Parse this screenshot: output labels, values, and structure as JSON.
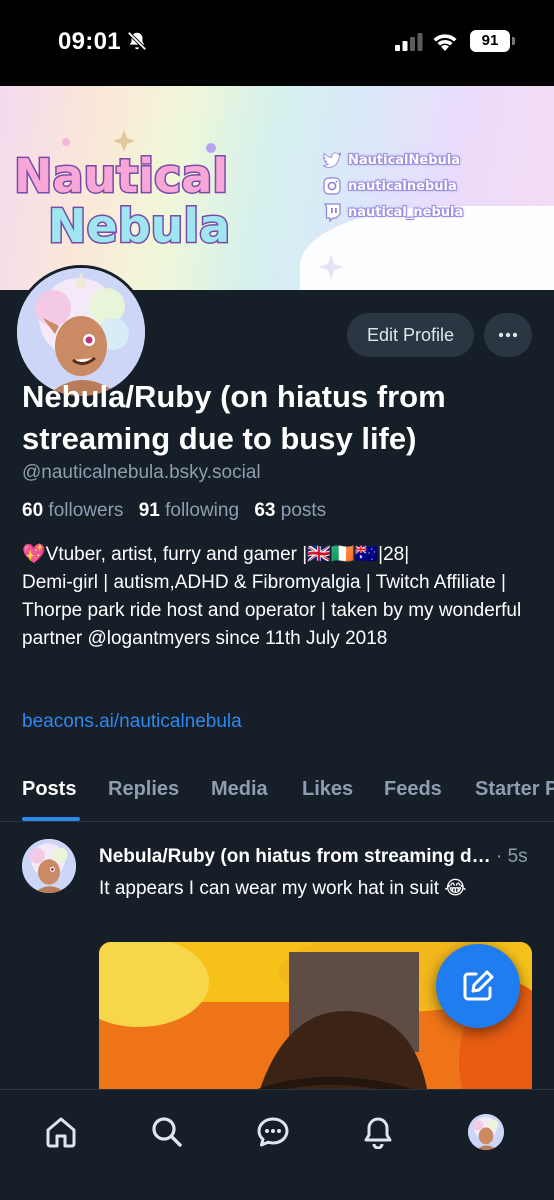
{
  "status_bar": {
    "time": "09:01",
    "battery": "91"
  },
  "banner": {
    "logo_line1": "Nautical",
    "logo_line2": "Nebula",
    "socials": [
      {
        "icon": "twitter-icon",
        "text": "NauticalNebula"
      },
      {
        "icon": "instagram-icon",
        "text": "nauticalnebula"
      },
      {
        "icon": "twitch-icon",
        "text": "nautical_nebula"
      }
    ]
  },
  "profile": {
    "edit_button": "Edit Profile",
    "display_name": "Nebula/Ruby (on hiatus from streaming due to busy life)",
    "handle": "@nauticalnebula.bsky.social",
    "followers_count": "60",
    "followers_label": "followers",
    "following_count": "91",
    "following_label": "following",
    "posts_count": "63",
    "posts_label": "posts",
    "bio": "💖Vtuber, artist, furry and gamer |🇬🇧🇮🇪🇦🇺|28|\nDemi-girl | autism,ADHD & Fibromyalgia | Twitch Affiliate | Thorpe park ride host and operator | taken by my wonderful partner @logantmyers since 11th July 2018",
    "link": "beacons.ai/nauticalnebula"
  },
  "tabs": [
    "Posts",
    "Replies",
    "Media",
    "Likes",
    "Feeds",
    "Starter Packs"
  ],
  "post": {
    "author": "Nebula/Ruby (on hiatus from streaming due to busy life)",
    "time": "· 5s",
    "text": "It appears I can wear my work hat in suit 😂"
  },
  "colors": {
    "background": "#161e27",
    "accent": "#2f88f0",
    "muted": "#8f9db0",
    "button": "#2b3643"
  }
}
